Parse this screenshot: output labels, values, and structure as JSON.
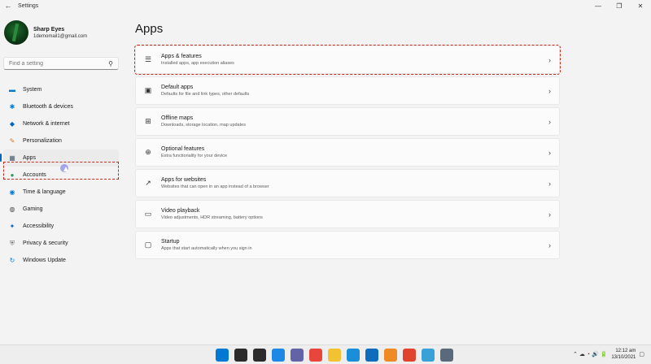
{
  "window": {
    "title": "Settings",
    "back_glyph": "←",
    "minimize_glyph": "—",
    "maximize_glyph": "❐",
    "close_glyph": "✕"
  },
  "profile": {
    "name": "Sharp Eyes",
    "email": "1demomail1@gmail.com"
  },
  "search": {
    "placeholder": "Find a setting",
    "icon": "search-icon"
  },
  "nav": {
    "items": [
      {
        "label": "System",
        "icon": "system-icon",
        "color": "#0078d4",
        "glyph": "▬"
      },
      {
        "label": "Bluetooth & devices",
        "icon": "bluetooth-icon",
        "color": "#0078d4",
        "glyph": "✱"
      },
      {
        "label": "Network & internet",
        "icon": "wifi-icon",
        "color": "#0067c0",
        "glyph": "◆"
      },
      {
        "label": "Personalization",
        "icon": "brush-icon",
        "color": "#d97a2b",
        "glyph": "✎"
      },
      {
        "label": "Apps",
        "icon": "apps-icon",
        "color": "#4a5d73",
        "glyph": "▦"
      },
      {
        "label": "Accounts",
        "icon": "account-icon",
        "color": "#2e9a5a",
        "glyph": "●"
      },
      {
        "label": "Time & language",
        "icon": "globe-icon",
        "color": "#0078d4",
        "glyph": "◉"
      },
      {
        "label": "Gaming",
        "icon": "gaming-icon",
        "color": "#4c4c4c",
        "glyph": "◍"
      },
      {
        "label": "Accessibility",
        "icon": "accessibility-icon",
        "color": "#0067c0",
        "glyph": "✦"
      },
      {
        "label": "Privacy & security",
        "icon": "shield-icon",
        "color": "#6b6b6b",
        "glyph": "⛨"
      },
      {
        "label": "Windows Update",
        "icon": "update-icon",
        "color": "#0078d4",
        "glyph": "↻"
      }
    ],
    "selected": "Apps"
  },
  "main": {
    "title": "Apps",
    "cards": [
      {
        "title": "Apps & features",
        "desc": "Installed apps, app execution aliases",
        "icon": "list-icon",
        "glyph": "☰"
      },
      {
        "title": "Default apps",
        "desc": "Defaults for file and link types, other defaults",
        "icon": "default-apps-icon",
        "glyph": "▣"
      },
      {
        "title": "Offline maps",
        "desc": "Downloads, storage location, map updates",
        "icon": "map-icon",
        "glyph": "⊞"
      },
      {
        "title": "Optional features",
        "desc": "Extra functionality for your device",
        "icon": "optional-features-icon",
        "glyph": "⊕"
      },
      {
        "title": "Apps for websites",
        "desc": "Websites that can open in an app instead of a browser",
        "icon": "website-app-icon",
        "glyph": "↗"
      },
      {
        "title": "Video playback",
        "desc": "Video adjustments, HDR streaming, battery options",
        "icon": "video-icon",
        "glyph": "▭"
      },
      {
        "title": "Startup",
        "desc": "Apps that start automatically when you sign in",
        "icon": "startup-icon",
        "glyph": "▢"
      }
    ],
    "chevron": "›"
  },
  "taskbar": {
    "apps": [
      {
        "icon": "windows-start-icon",
        "color": "#0078d4"
      },
      {
        "icon": "search-icon",
        "color": "#2b2b2b"
      },
      {
        "icon": "task-view-icon",
        "color": "#2b2b2b"
      },
      {
        "icon": "widgets-icon",
        "color": "#1e88e5"
      },
      {
        "icon": "chat-icon",
        "color": "#6264a7"
      },
      {
        "icon": "chrome-icon",
        "color": "#e8453c"
      },
      {
        "icon": "file-explorer-icon",
        "color": "#f2c232"
      },
      {
        "icon": "edge-icon",
        "color": "#1a8ed9"
      },
      {
        "icon": "store-icon",
        "color": "#0f6cbd"
      },
      {
        "icon": "app-icon",
        "color": "#f08a24"
      },
      {
        "icon": "recorder-icon",
        "color": "#e0442c"
      },
      {
        "icon": "photos-icon",
        "color": "#3aa0d8"
      },
      {
        "icon": "settings-icon",
        "color": "#5a6a7a"
      }
    ],
    "time": "12:12 am",
    "date": "13/10/2021",
    "tray_glyphs": "⌃  ☁  ◔  🔊  🔋"
  }
}
